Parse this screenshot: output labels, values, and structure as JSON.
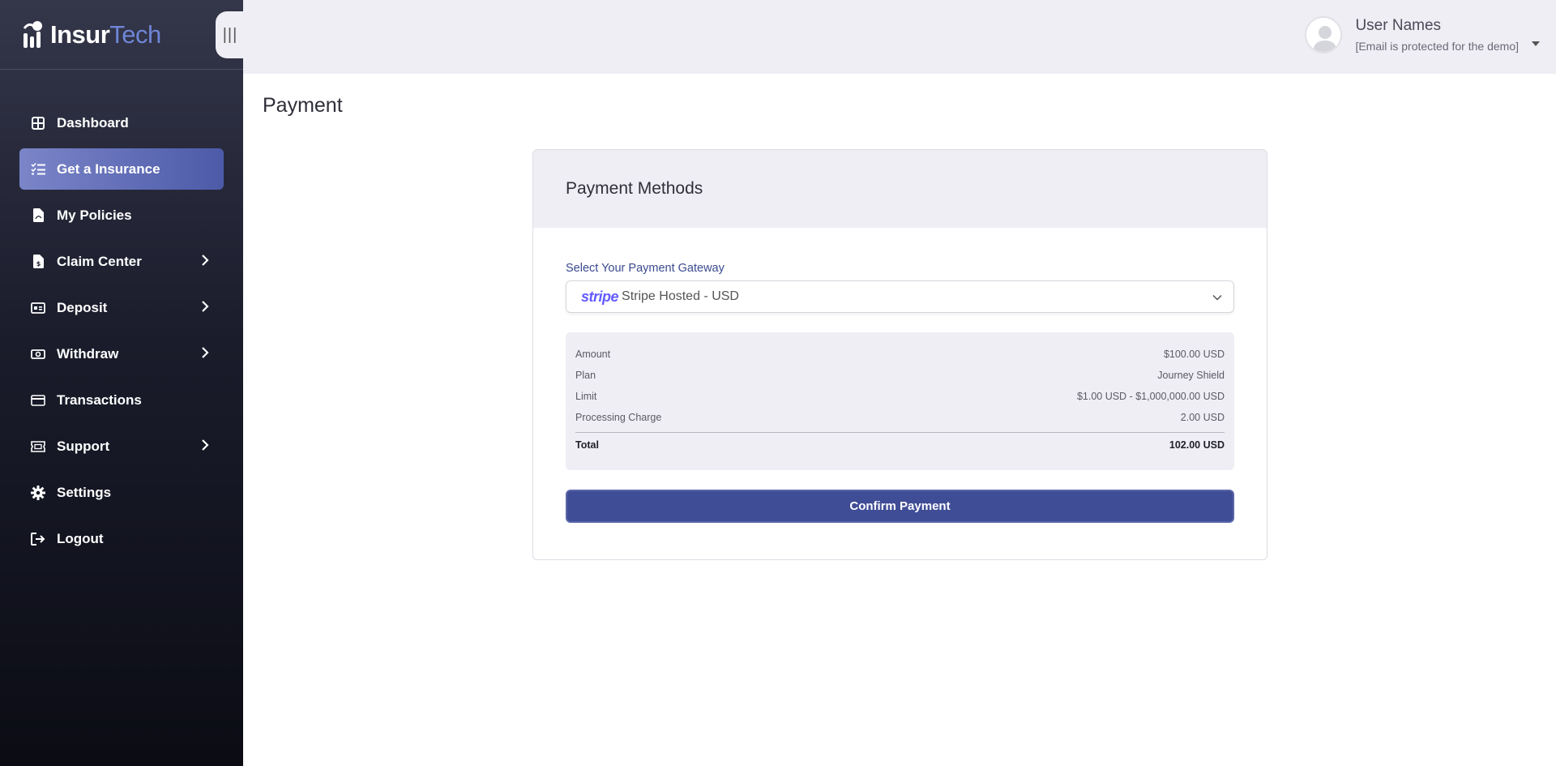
{
  "brand": {
    "name_part1": "Insur",
    "name_part2": "Tech"
  },
  "sidebar": {
    "toggle_icon": "|||",
    "items": [
      {
        "label": "Dashboard",
        "icon": "grid-icon",
        "active": false,
        "has_submenu": false
      },
      {
        "label": "Get a Insurance",
        "icon": "checklist-icon",
        "active": true,
        "has_submenu": false
      },
      {
        "label": "My Policies",
        "icon": "file-pdf-icon",
        "active": false,
        "has_submenu": false
      },
      {
        "label": "Claim Center",
        "icon": "file-dollar-icon",
        "active": false,
        "has_submenu": true
      },
      {
        "label": "Deposit",
        "icon": "money-check-icon",
        "active": false,
        "has_submenu": true
      },
      {
        "label": "Withdraw",
        "icon": "money-bill-icon",
        "active": false,
        "has_submenu": true
      },
      {
        "label": "Transactions",
        "icon": "credit-card-icon",
        "active": false,
        "has_submenu": false
      },
      {
        "label": "Support",
        "icon": "ticket-icon",
        "active": false,
        "has_submenu": true
      },
      {
        "label": "Settings",
        "icon": "gear-icon",
        "active": false,
        "has_submenu": false
      },
      {
        "label": "Logout",
        "icon": "logout-icon",
        "active": false,
        "has_submenu": false
      }
    ]
  },
  "header": {
    "user_name": "User Names",
    "user_email": "[Email is protected for the demo]"
  },
  "page": {
    "title": "Payment"
  },
  "payment": {
    "card_title": "Payment Methods",
    "gateway_label": "Select Your Payment Gateway",
    "gateway_logo": "stripe",
    "gateway_value": "Stripe Hosted - USD",
    "summary": [
      {
        "label": "Amount",
        "value": "$100.00 USD"
      },
      {
        "label": "Plan",
        "value": "Journey Shield"
      },
      {
        "label": "Limit",
        "value": "$1.00 USD - $1,000,000.00 USD"
      },
      {
        "label": "Processing Charge",
        "value": "2.00 USD"
      }
    ],
    "total": {
      "label": "Total",
      "value": "102.00 USD"
    },
    "confirm_label": "Confirm Payment"
  },
  "colors": {
    "accent": "#3f4d96",
    "active_nav": "#6b76c0",
    "stripe": "#635bff",
    "logo_tech": "#6f86d6"
  }
}
